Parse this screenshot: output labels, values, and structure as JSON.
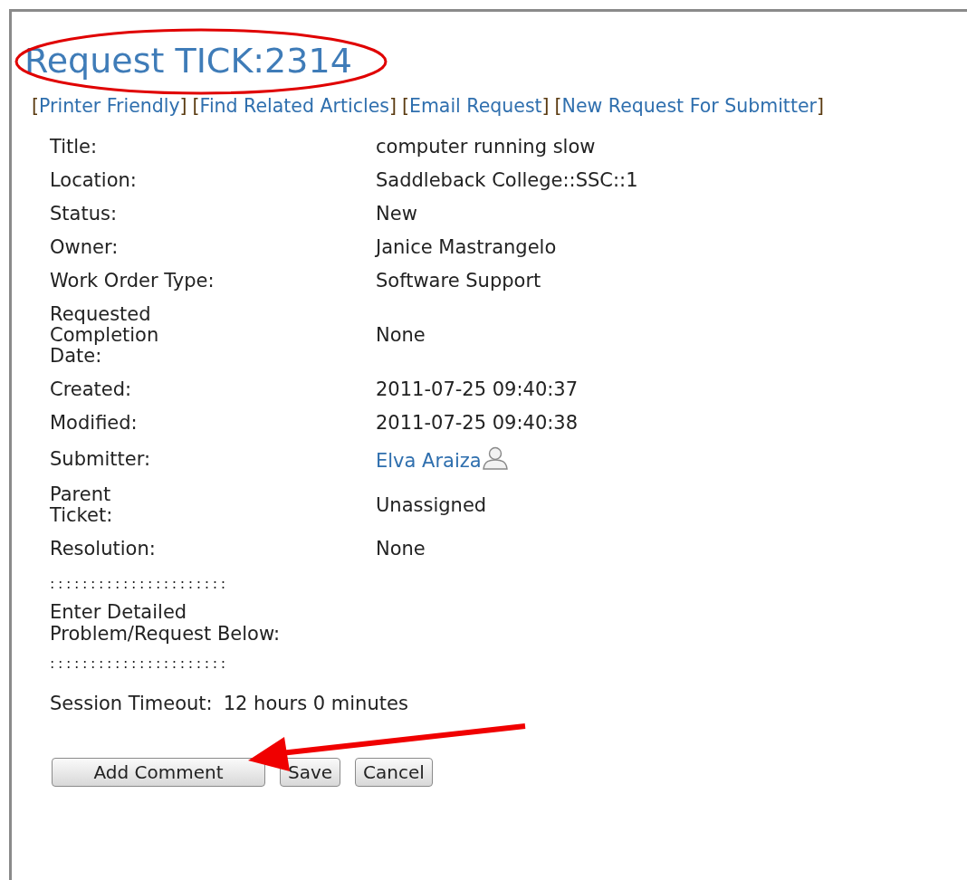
{
  "title": "Request TICK:2314",
  "links": [
    "[Printer Friendly]",
    "[Find Related Articles]",
    "[Email Request]",
    "[New Request For Submitter]"
  ],
  "fields": [
    {
      "label": "Title:",
      "value": "computer running slow",
      "kind": "text"
    },
    {
      "label": "Location:",
      "value": "Saddleback College::SSC::1",
      "kind": "text"
    },
    {
      "label": "Status:",
      "value": "New",
      "kind": "text"
    },
    {
      "label": "Owner:",
      "value": "Janice Mastrangelo",
      "kind": "text"
    },
    {
      "label": "Work Order Type:",
      "value": "Software Support",
      "kind": "text"
    },
    {
      "label": "Requested\nCompletion\nDate:",
      "value": "None",
      "kind": "text"
    },
    {
      "label": "Created:",
      "value": "2011-07-25 09:40:37",
      "kind": "text"
    },
    {
      "label": "Modified:",
      "value": "2011-07-25 09:40:38",
      "kind": "text"
    },
    {
      "label": "Submitter:",
      "value": "Elva Araiza",
      "kind": "person"
    },
    {
      "label": "Parent\nTicket:",
      "value": "Unassigned",
      "kind": "text"
    },
    {
      "label": "Resolution:",
      "value": "None",
      "kind": "text"
    }
  ],
  "section": {
    "divider_top": "::::::::::::::::::::::",
    "heading": "Enter Detailed\nProblem/Request Below:",
    "divider_bottom": "::::::::::::::::::::::"
  },
  "session": {
    "label": "Session Timeout:",
    "value": "12 hours 0 minutes"
  },
  "buttons": [
    "Add Comment",
    "Save",
    "Cancel"
  ]
}
